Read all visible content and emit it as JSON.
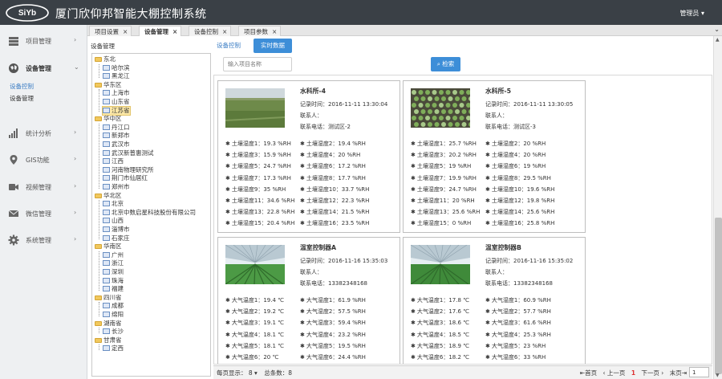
{
  "app": {
    "title": "厦门欣仰邦智能大棚控制系统",
    "user": "管理员 ▾"
  },
  "sidebar": {
    "items": [
      {
        "label": "项目管理",
        "icon": "server-icon"
      },
      {
        "label": "设备管理",
        "icon": "globe-icon"
      },
      {
        "label": "统计分析",
        "icon": "bar-chart-icon"
      },
      {
        "label": "GIS功能",
        "icon": "map-pin-icon"
      },
      {
        "label": "视频管理",
        "icon": "video-camera-icon"
      },
      {
        "label": "微信管理",
        "icon": "envelope-icon"
      },
      {
        "label": "系统管理",
        "icon": "gear-icon"
      }
    ],
    "sub_items": [
      "设备控制",
      "设备管理"
    ]
  },
  "tabs": [
    "项目设置",
    "设备管理",
    "设备控制",
    "项目参数"
  ],
  "tree": {
    "title": "设备管理",
    "nodes": [
      {
        "label": "东北",
        "type": "folder",
        "level": 0
      },
      {
        "label": "哈尔滨",
        "type": "leaf",
        "level": 1
      },
      {
        "label": "黑龙江",
        "type": "leaf",
        "level": 1
      },
      {
        "label": "华东区",
        "type": "folder",
        "level": 0
      },
      {
        "label": "上海市",
        "type": "leaf",
        "level": 1
      },
      {
        "label": "山东省",
        "type": "leaf",
        "level": 1
      },
      {
        "label": "江苏省",
        "type": "leaf",
        "level": 1,
        "selected": true
      },
      {
        "label": "华中区",
        "type": "folder",
        "level": 0
      },
      {
        "label": "丹江口",
        "type": "leaf",
        "level": 1
      },
      {
        "label": "新郑市",
        "type": "leaf",
        "level": 1
      },
      {
        "label": "武汉市",
        "type": "leaf",
        "level": 1
      },
      {
        "label": "武汉新普惠测试",
        "type": "leaf",
        "level": 1
      },
      {
        "label": "江西",
        "type": "leaf",
        "level": 1
      },
      {
        "label": "河南物理研究所",
        "type": "leaf",
        "level": 1
      },
      {
        "label": "荆门市仙居红",
        "type": "leaf",
        "level": 1
      },
      {
        "label": "郑州市",
        "type": "leaf",
        "level": 1
      },
      {
        "label": "华北区",
        "type": "folder",
        "level": 0
      },
      {
        "label": "北京",
        "type": "leaf",
        "level": 1
      },
      {
        "label": "北京中数启星科技股份有限公司",
        "type": "leaf",
        "level": 1
      },
      {
        "label": "山西",
        "type": "leaf",
        "level": 1
      },
      {
        "label": "淄博市",
        "type": "leaf",
        "level": 1
      },
      {
        "label": "石家庄",
        "type": "leaf",
        "level": 1
      },
      {
        "label": "华南区",
        "type": "folder",
        "level": 0
      },
      {
        "label": "广州",
        "type": "leaf",
        "level": 1
      },
      {
        "label": "浙江",
        "type": "leaf",
        "level": 1
      },
      {
        "label": "深圳",
        "type": "leaf",
        "level": 1
      },
      {
        "label": "珠海",
        "type": "leaf",
        "level": 1
      },
      {
        "label": "福建",
        "type": "leaf",
        "level": 1
      },
      {
        "label": "四川省",
        "type": "folder",
        "level": 0
      },
      {
        "label": "成都",
        "type": "leaf",
        "level": 1
      },
      {
        "label": "绵阳",
        "type": "leaf",
        "level": 1
      },
      {
        "label": "湖南省",
        "type": "folder",
        "level": 0
      },
      {
        "label": "长沙",
        "type": "leaf",
        "level": 1
      },
      {
        "label": "甘肃省",
        "type": "folder",
        "level": 0
      },
      {
        "label": "定西",
        "type": "leaf",
        "level": 1
      }
    ]
  },
  "subtabs": {
    "control": "设备控制",
    "realtime": "实时数据"
  },
  "search": {
    "placeholder": "输入项目名称",
    "button": "检索"
  },
  "cards": [
    {
      "title": "水科所-4",
      "record_time": "记录时间：2016-11-11 13:30:04",
      "contact": "联系人：",
      "phone": "联系电话：测试区-2",
      "photo": "field",
      "readings": [
        "土壤湿度1：19.3 %RH",
        "土壤湿度2：19.4 %RH",
        "土壤湿度3：15.9 %RH",
        "土壤湿度4：20 %RH",
        "土壤湿度5：24.7 %RH",
        "土壤湿度6：17.2 %RH",
        "土壤湿度7：17.3 %RH",
        "土壤湿度8：17.7 %RH",
        "土壤湿度9：35 %RH",
        "土壤湿度10：33.7 %RH",
        "土壤湿度11：34.6 %RH",
        "土壤湿度12：22.3 %RH",
        "土壤湿度13：22.8 %RH",
        "土壤湿度14：21.5 %RH",
        "土壤湿度15：20.4 %RH",
        "土壤湿度16：23.5 %RH"
      ]
    },
    {
      "title": "水科所-5",
      "record_time": "记录时间：2016-11-11 13:30:05",
      "contact": "联系人：",
      "phone": "联系电话：测试区-3",
      "photo": "crops",
      "readings": [
        "土壤湿度1：25.7 %RH",
        "土壤湿度2：20 %RH",
        "土壤湿度3：20.2 %RH",
        "土壤湿度4：20 %RH",
        "土壤湿度5：19 %RH",
        "土壤湿度6：19 %RH",
        "土壤湿度7：19.9 %RH",
        "土壤湿度8：29.5 %RH",
        "土壤湿度9：24.7 %RH",
        "土壤湿度10：19.6 %RH",
        "土壤湿度11：20 %RH",
        "土壤湿度12：19.8 %RH",
        "土壤湿度13：25.6 %RH",
        "土壤湿度14：25.6 %RH",
        "土壤湿度15：0 %RH",
        "土壤湿度16：25.8 %RH"
      ]
    },
    {
      "title": "温室控制器A",
      "record_time": "记录时间：2016-11-16 15:35:03",
      "contact": "联系人：",
      "phone": "联系电话：13382348168",
      "photo": "greenhouse",
      "readings": [
        "大气温度1：19.4 ℃",
        "大气湿度1：61.9 %RH",
        "大气温度2：19.2 ℃",
        "大气湿度2：57.5 %RH",
        "大气温度3：19.1 ℃",
        "大气湿度3：59.4 %RH",
        "大气温度4：18.1 ℃",
        "大气湿度4：23.2 %RH",
        "大气温度5：18.1 ℃",
        "大气湿度5：19.5 %RH",
        "大气温度6：20 ℃",
        "大气湿度6：24.4 %RH"
      ]
    },
    {
      "title": "温室控制器B",
      "record_time": "记录时间：2016-11-16 15:35:02",
      "contact": "联系人：",
      "phone": "联系电话：13382348168",
      "photo": "greenhouse2",
      "readings": [
        "大气温度1：17.8 ℃",
        "大气湿度1：60.9 %RH",
        "大气温度2：17.6 ℃",
        "大气湿度2：57.7 %RH",
        "大气温度3：18.6 ℃",
        "大气湿度3：61.6 %RH",
        "大气温度4：18.5 ℃",
        "大气湿度4：25.3 %RH",
        "大气温度5：18.9 ℃",
        "大气湿度5：23 %RH",
        "大气温度6：18.2 ℃",
        "大气湿度6：33 %RH"
      ]
    }
  ],
  "pager": {
    "per_page": "每页显示： 8",
    "total": "总条数：8",
    "first": "首页",
    "prev": "上一页",
    "current": "1",
    "next": "下一页",
    "last": "末页",
    "page_value": "1"
  }
}
